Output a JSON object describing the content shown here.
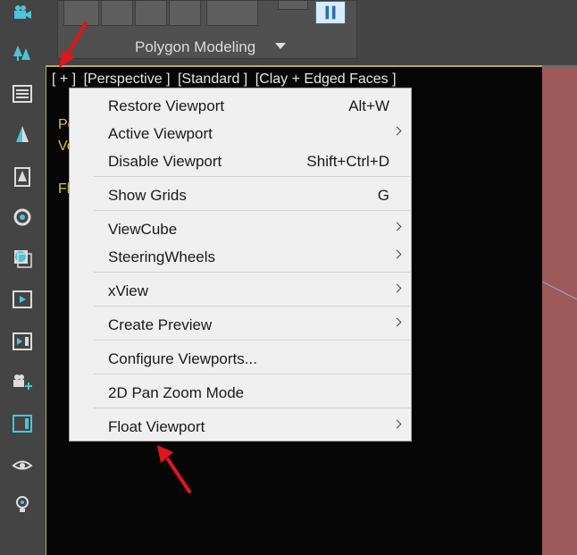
{
  "ribbon": {
    "label": "Polygon Modeling"
  },
  "viewport": {
    "labels": [
      "[ + ]",
      "[Perspective ]",
      "[Standard ]",
      "[Clay + Edged Faces ]"
    ],
    "stats_partial": [
      "Po",
      "Ve",
      "Fl"
    ]
  },
  "menu": {
    "items": [
      {
        "label": "Restore Viewport",
        "shortcut": "Alt+W",
        "submenu": false
      },
      {
        "label": "Active Viewport",
        "shortcut": "",
        "submenu": true
      },
      {
        "label": "Disable Viewport",
        "shortcut": "Shift+Ctrl+D",
        "submenu": false
      },
      {
        "label": "Show Grids",
        "shortcut": "G",
        "submenu": false
      },
      {
        "label": "ViewCube",
        "shortcut": "",
        "submenu": true
      },
      {
        "label": "SteeringWheels",
        "shortcut": "",
        "submenu": true
      },
      {
        "label": "xView",
        "shortcut": "",
        "submenu": true
      },
      {
        "label": "Create Preview",
        "shortcut": "",
        "submenu": true
      },
      {
        "label": "Configure Viewports...",
        "shortcut": "",
        "submenu": false
      },
      {
        "label": "2D Pan Zoom Mode",
        "shortcut": "",
        "submenu": false
      },
      {
        "label": "Float Viewport",
        "shortcut": "",
        "submenu": true
      }
    ]
  },
  "colors": {
    "viewport_border": "#bda84a",
    "stat_text": "#d8c04a",
    "annotation_arrow": "#e0161b",
    "toolbar_icon": "#49c6d8"
  },
  "icons": [
    "camera-icon",
    "tree-icon",
    "list-icon",
    "tree-half-icon",
    "tree-box-icon",
    "rotate-icon",
    "material-icon",
    "play-frame-icon",
    "render-frame-icon",
    "camera-add-icon",
    "panel-icon",
    "eye-icon",
    "lightbulb-icon"
  ]
}
